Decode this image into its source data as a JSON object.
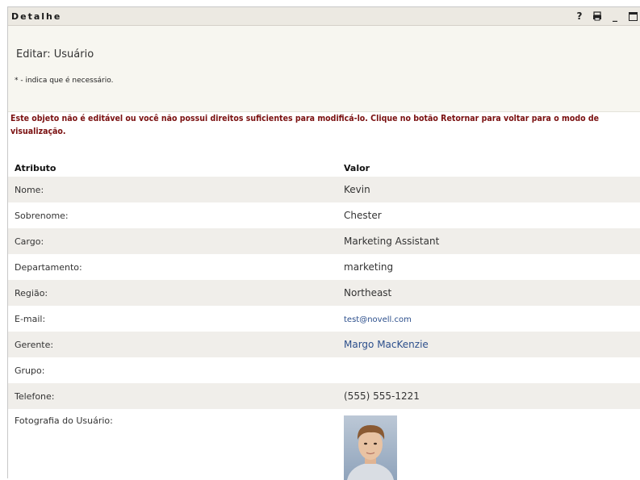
{
  "window": {
    "title": "Detalhe",
    "help_glyph": "?",
    "print_glyph": "⎙",
    "minimize_glyph": "_",
    "maximize_glyph": "□"
  },
  "header": {
    "page_title": "Editar: Usuário",
    "required_note": "* - indica que é necessário."
  },
  "warning": "Este objeto não é editável ou você não possui direitos suficientes para modificá-lo. Clique no botão Retornar para voltar para o modo de visualização.",
  "table": {
    "headers": [
      "Atributo",
      "Valor"
    ],
    "rows": [
      {
        "label": "Nome:",
        "value": "Kevin"
      },
      {
        "label": "Sobrenome:",
        "value": "Chester"
      },
      {
        "label": "Cargo:",
        "value": "Marketing Assistant"
      },
      {
        "label": "Departamento:",
        "value": "marketing"
      },
      {
        "label": "Região:",
        "value": "Northeast"
      },
      {
        "label": "E-mail:",
        "value": "test@novell.com"
      },
      {
        "label": "Gerente:",
        "value": "Margo MacKenzie"
      },
      {
        "label": "Grupo:",
        "value": ""
      },
      {
        "label": "Telefone:",
        "value": "(555) 555-1221"
      },
      {
        "label": "Fotografia do Usuário:",
        "value": ""
      }
    ]
  },
  "colors": {
    "warning": "#7a1010",
    "link": "#2c4f8c",
    "row_alt": "#f0eeea",
    "header_bg": "#f7f6f0"
  },
  "icons": [
    "help-icon",
    "print-icon",
    "minimize-icon",
    "maximize-icon"
  ]
}
